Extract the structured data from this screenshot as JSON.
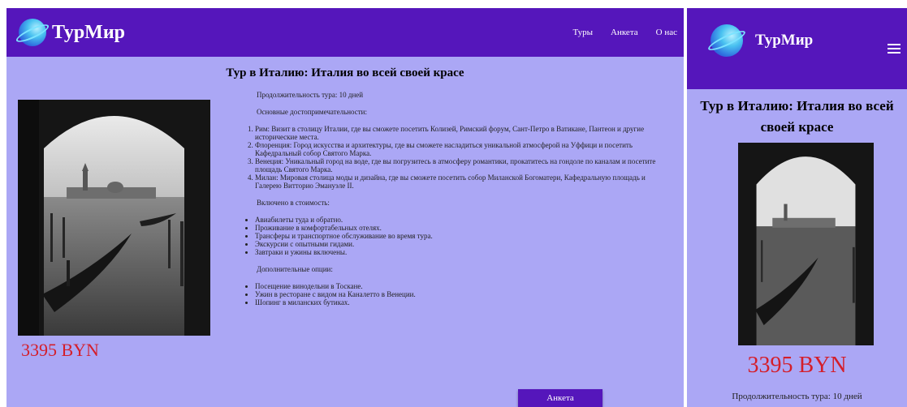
{
  "brand": {
    "name": "ТурМир"
  },
  "nav": [
    {
      "label": "Туры"
    },
    {
      "label": "Анкета"
    },
    {
      "label": "О нас"
    }
  ],
  "tour": {
    "title": "Тур в Италию: Италия во всей своей красе",
    "price": "3395 BYN",
    "duration": "Продолжительность тура: 10 дней",
    "sights_heading": "Основные достопримечательности:",
    "sights": [
      "Рим: Визит в столицу Италии, где вы сможете посетить Колизей, Римский форум, Сант-Петро в Ватикане, Пантеон и другие исторические места.",
      "Флоренция: Город искусства и архитектуры, где вы сможете насладиться уникальной атмосферой на Уффици и посетить Кафедральный собор Святого Марка.",
      "Венеция: Уникальный город на воде, где вы погрузитесь в атмосферу романтики, прокатитесь на гондоле по каналам и посетите площадь Святого Марка.",
      "Милан: Мировая столица моды и дизайна, где вы сможете посетить собор Миланской Богоматери, Кафедральную площадь и Галерею Витторио Эмануэле II."
    ],
    "included_heading": "Включено в стоимость:",
    "included": [
      "Авиабилеты туда и обратно.",
      "Проживание в комфортабельных отелях.",
      "Трансферы и транспортное обслуживание во время тура.",
      "Экскурсии с опытными гидами.",
      "Завтраки и ужины включены."
    ],
    "options_heading": "Дополнительные опции:",
    "options": [
      "Посещение винодельни в Тоскане.",
      "Ужин в ресторане с видом на Каналетто в Венеции.",
      "Шопинг в миланских бутиках."
    ]
  },
  "form_button": {
    "label": "Анкета"
  },
  "colors": {
    "header": "#5516bb",
    "background": "#aba7f5",
    "price": "#d41e2a"
  }
}
